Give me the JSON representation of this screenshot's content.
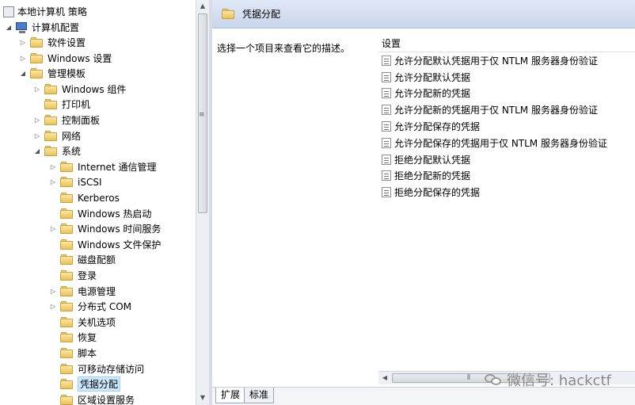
{
  "tree": {
    "root_label": "本地计算机 策略",
    "computer_config_label": "计算机配置",
    "items": [
      {
        "label": "软件设置",
        "level": 2,
        "expander": "▷"
      },
      {
        "label": "Windows 设置",
        "level": 2,
        "expander": "▷"
      },
      {
        "label": "管理模板",
        "level": 2,
        "expander": "◢"
      },
      {
        "label": "Windows 组件",
        "level": 3,
        "expander": "▷"
      },
      {
        "label": "打印机",
        "level": 3,
        "expander": ""
      },
      {
        "label": "控制面板",
        "level": 3,
        "expander": "▷"
      },
      {
        "label": "网络",
        "level": 3,
        "expander": "▷"
      },
      {
        "label": "系统",
        "level": 3,
        "expander": "◢"
      },
      {
        "label": "Internet 通信管理",
        "level": 4,
        "expander": "▷"
      },
      {
        "label": "iSCSI",
        "level": 4,
        "expander": "▷"
      },
      {
        "label": "Kerberos",
        "level": 4,
        "expander": ""
      },
      {
        "label": "Windows 热启动",
        "level": 4,
        "expander": ""
      },
      {
        "label": "Windows 时间服务",
        "level": 4,
        "expander": "▷"
      },
      {
        "label": "Windows 文件保护",
        "level": 4,
        "expander": ""
      },
      {
        "label": "磁盘配额",
        "level": 4,
        "expander": ""
      },
      {
        "label": "登录",
        "level": 4,
        "expander": ""
      },
      {
        "label": "电源管理",
        "level": 4,
        "expander": "▷"
      },
      {
        "label": "分布式 COM",
        "level": 4,
        "expander": "▷"
      },
      {
        "label": "关机选项",
        "level": 4,
        "expander": ""
      },
      {
        "label": "恢复",
        "level": 4,
        "expander": ""
      },
      {
        "label": "脚本",
        "level": 4,
        "expander": ""
      },
      {
        "label": "可移动存储访问",
        "level": 4,
        "expander": ""
      },
      {
        "label": "凭据分配",
        "level": 4,
        "expander": "",
        "selected": true
      },
      {
        "label": "区域设置服务",
        "level": 4,
        "expander": ""
      }
    ]
  },
  "right": {
    "header_title": "凭据分配",
    "description": "选择一个项目来查看它的描述。",
    "settings_header": "设置",
    "settings": [
      "允许分配默认凭据用于仅 NTLM 服务器身份验证",
      "允许分配默认凭据",
      "允许分配新的凭据",
      "允许分配新的凭据用于仅 NTLM 服务器身份验证",
      "允许分配保存的凭据",
      "允许分配保存的凭据用于仅 NTLM 服务器身份验证",
      "拒绝分配默认凭据",
      "拒绝分配新的凭据",
      "拒绝分配保存的凭据"
    ]
  },
  "tabs": {
    "extended": "扩展",
    "standard": "标准"
  },
  "watermark": {
    "text": "微信号: hackctf",
    "icon": "wechat-icon"
  },
  "colors": {
    "header_bg": "#c9d6ea",
    "selected_bg": "#cce8ff",
    "folder": "#e9c25b"
  }
}
